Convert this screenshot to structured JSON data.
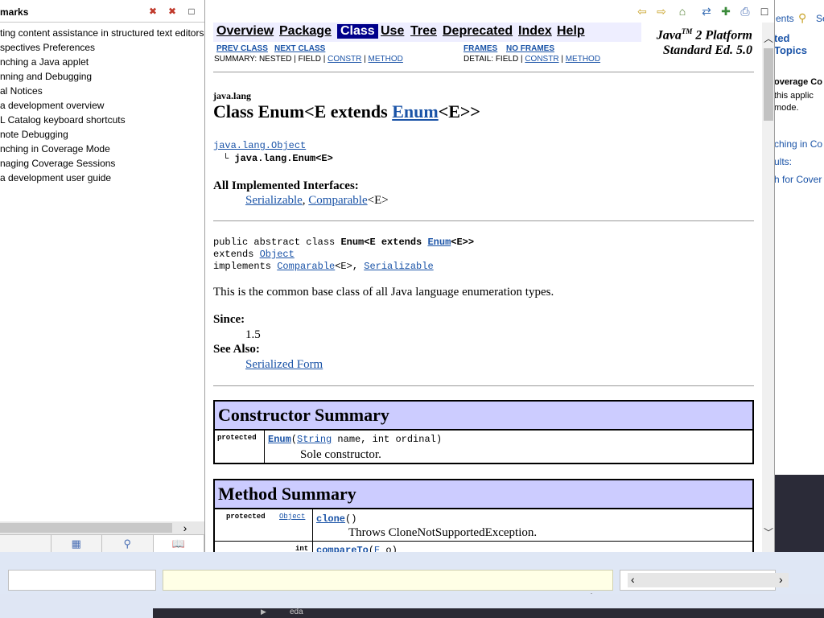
{
  "bookmarks": {
    "title": "marks",
    "items": [
      "ting content assistance in structured text editors",
      "spectives Preferences",
      "nching a Java applet",
      "nning and Debugging",
      "al Notices",
      "a development overview",
      "L Catalog keyboard shortcuts",
      "note Debugging",
      "nching in Coverage Mode",
      "naging Coverage Sessions",
      "a development user guide"
    ]
  },
  "nav": {
    "overview": "Overview",
    "package": "Package",
    "class": "Class",
    "use": "Use",
    "tree": "Tree",
    "deprecated": "Deprecated",
    "index": "Index",
    "help": "Help",
    "platform_line1_a": "Java",
    "platform_tm": "TM",
    "platform_line1_b": " 2 Platform",
    "platform_line2": "Standard Ed. 5.0",
    "prev_class": "PREV CLASS",
    "next_class": "NEXT CLASS",
    "frames": "FRAMES",
    "no_frames": "NO FRAMES",
    "summary_prefix": "SUMMARY: NESTED | FIELD | ",
    "detail_prefix": "DETAIL: FIELD | ",
    "constr": "CONSTR",
    "sep": " | ",
    "method": "METHOD"
  },
  "doc": {
    "package": "java.lang",
    "title_prefix": "Class Enum<E extends ",
    "title_link": "Enum",
    "title_suffix": "<E>>",
    "hier_parent": "java.lang.Object",
    "hier_child": "java.lang.Enum<E>",
    "interfaces_label": "All Implemented Interfaces:",
    "iface_serializable": "Serializable",
    "iface_comma": ", ",
    "iface_comparable": "Comparable",
    "iface_generic": "<E>",
    "decl_line1_prefix": "public abstract class ",
    "decl_line1_bold": "Enum<E extends ",
    "decl_line1_link": "Enum",
    "decl_line1_end": "<E>>",
    "decl_line2_prefix": "extends ",
    "decl_line2_link": "Object",
    "decl_line3_prefix": "implements ",
    "decl_line3_link1": "Comparable",
    "decl_line3_mid": "<E>, ",
    "decl_line3_link2": "Serializable",
    "description": "This is the common base class of all Java language enumeration types.",
    "since_label": "Since:",
    "since_value": "1.5",
    "see_also_label": "See Also:",
    "see_also_link": "Serialized Form"
  },
  "constructor_summary": {
    "heading": "Constructor Summary",
    "rows": [
      {
        "modifier": "protected",
        "name": "Enum",
        "param_open": "(",
        "param_type": "String",
        "params_rest": " name, int ordinal)",
        "description": "Sole constructor."
      }
    ]
  },
  "method_summary": {
    "heading": "Method Summary",
    "rows": [
      {
        "modifier": "protected",
        "return_type": "Object",
        "name": "clone",
        "params": "()",
        "description": "Throws CloneNotSupportedException."
      },
      {
        "modifier": "int",
        "name": "compareTo",
        "params_open": "(",
        "param_type": "E",
        "params_rest": " o)"
      }
    ]
  },
  "right_panel": {
    "tab_contents": "ents",
    "tab_search": "Se",
    "related_topics": "ted Topics",
    "text1": "overage Co",
    "text2": "this applic",
    "text3": "mode.",
    "link1": "ching in Co",
    "link2": "ults:",
    "link3": "h for Cover"
  },
  "taskbar": {
    "item": "eda"
  }
}
